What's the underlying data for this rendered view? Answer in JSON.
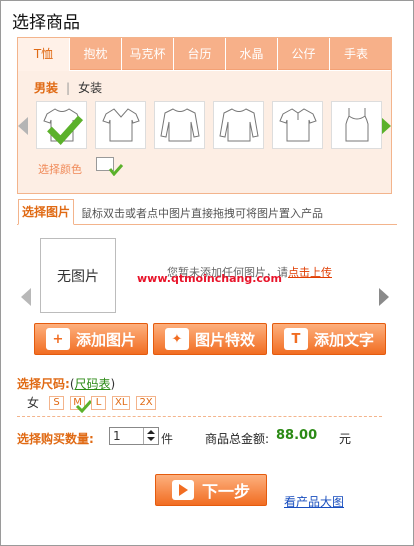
{
  "title": "选择商品",
  "product_tabs": [
    "T恤",
    "抱枕",
    "马克杯",
    "台历",
    "水晶",
    "公仔",
    "手表"
  ],
  "gender_tabs": [
    "男装",
    "女装"
  ],
  "color_label": "选择颜色",
  "image_panel": {
    "tab_label": "选择图片",
    "hint": "鼠标双击或者点中图片直接拖拽可将图片置入产品",
    "no_image": "无图片",
    "upload_text": "您暂未添加任何图片，请",
    "upload_link": "点击上传",
    "watermark": "www.qtmoinchang.com"
  },
  "buttons": {
    "add_image": "添加图片",
    "image_effects": "图片特效",
    "add_text": "添加文字",
    "next": "下一步"
  },
  "size": {
    "label": "选择尺码:",
    "open_paren": "(",
    "table_link": "尺码表",
    "close_paren": ")",
    "gender": "女",
    "options": [
      "S",
      "M",
      "L",
      "XL",
      "2X"
    ]
  },
  "quantity": {
    "label": "选择购买数量:",
    "value": "1",
    "unit": "件"
  },
  "total": {
    "label": "商品总金额:",
    "value": "88.00",
    "unit": "元"
  },
  "big_image_link": "看产品大图",
  "colors": {
    "accent": "#e06a14",
    "tab_bg": "#f7b089",
    "panel_bg": "#fdeee4",
    "price_green": "#2b8a15",
    "check_green": "#5bb12b"
  }
}
